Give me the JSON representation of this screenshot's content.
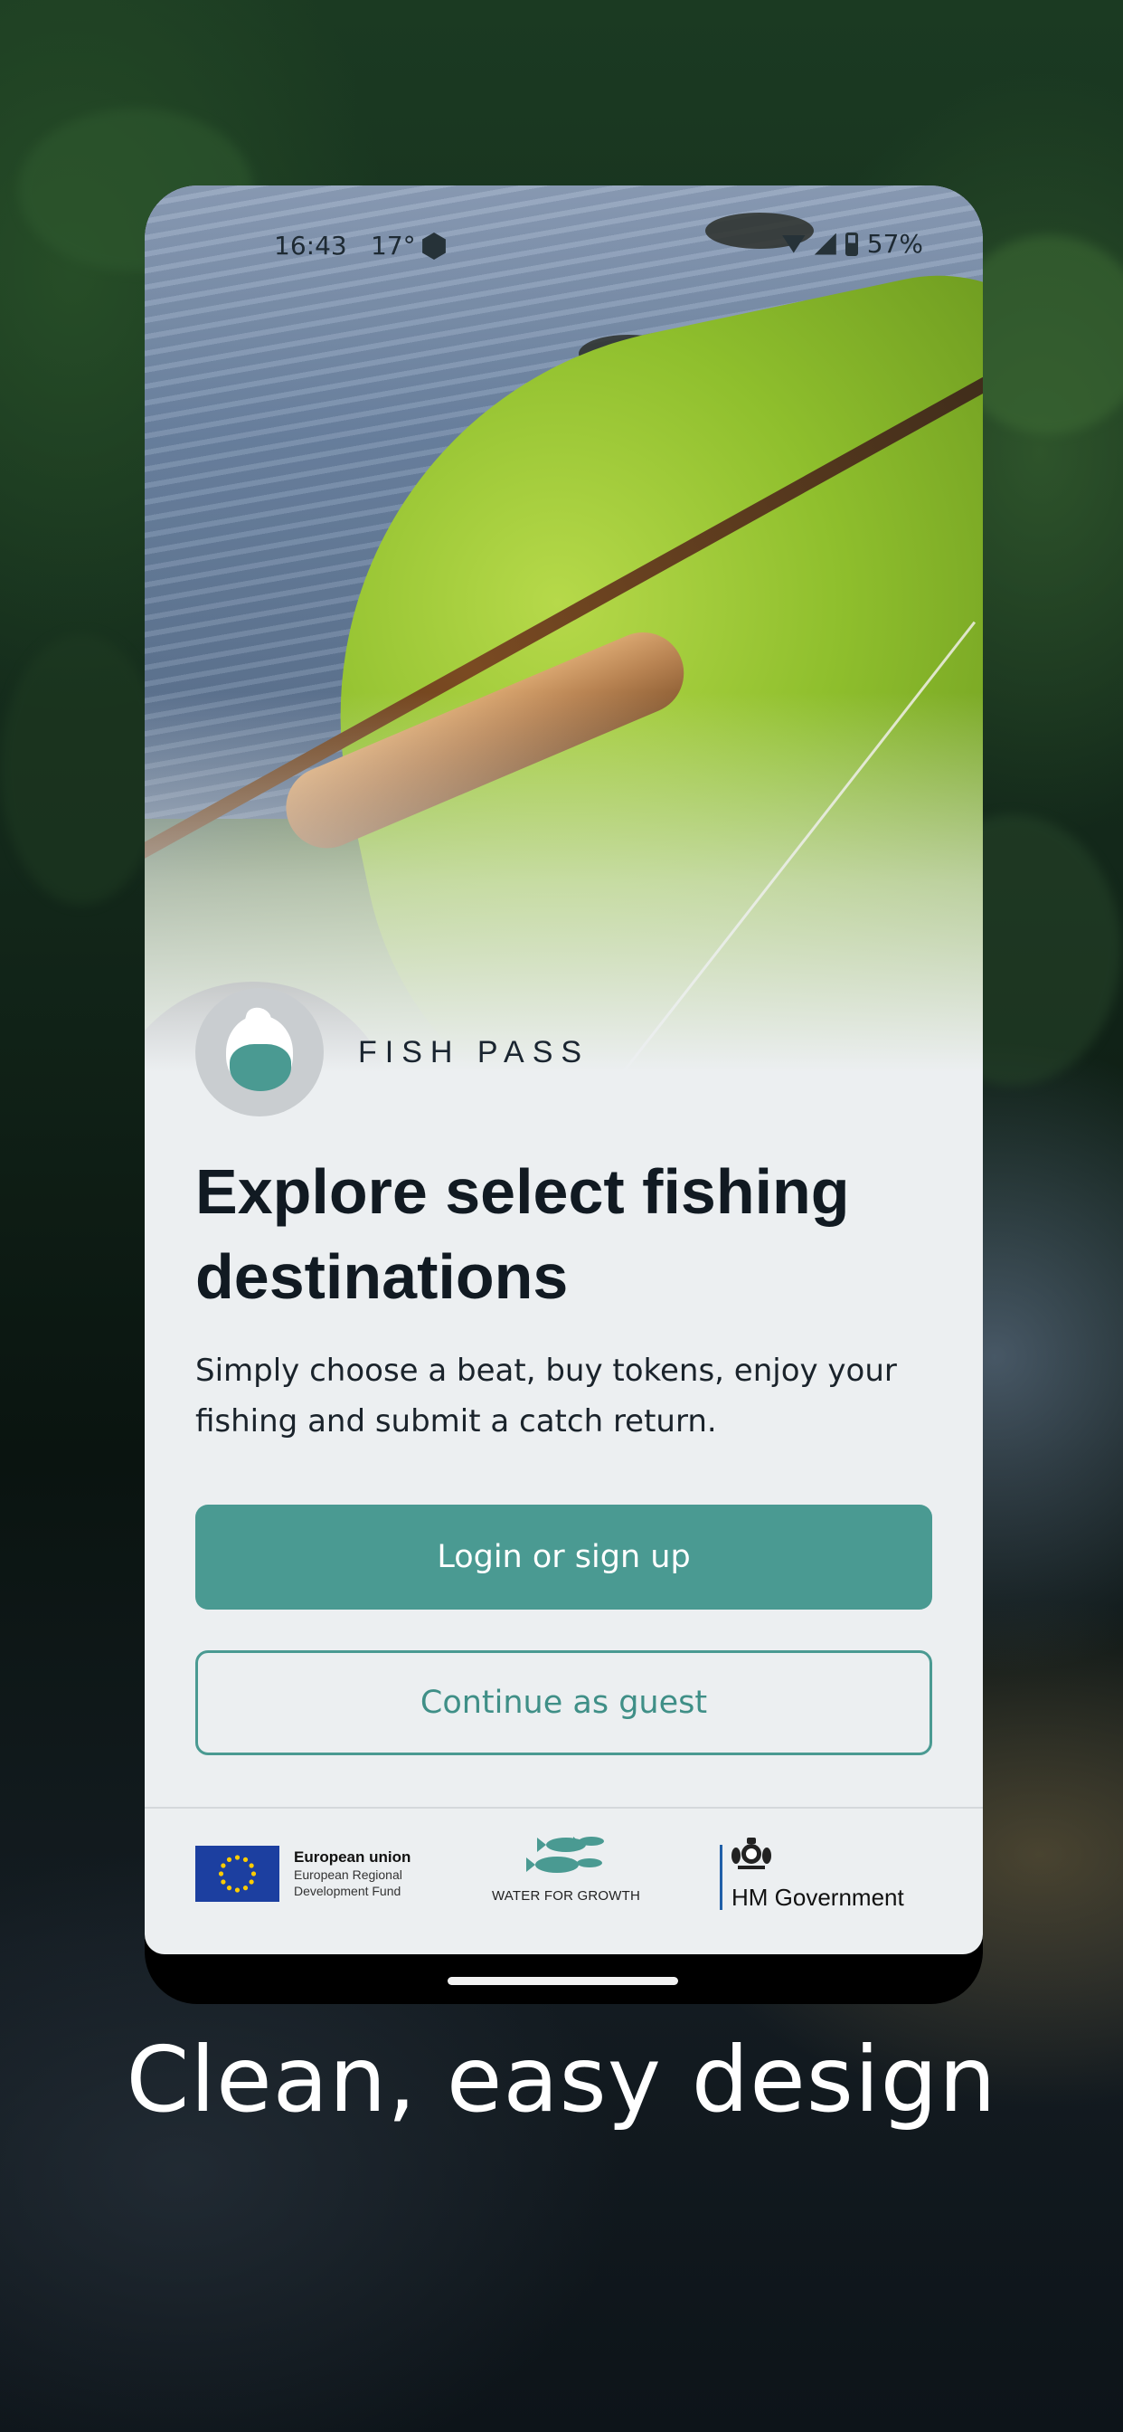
{
  "status_bar": {
    "time": "16:43",
    "temperature": "17°",
    "battery": "57%",
    "icons": [
      "weather-icon",
      "wifi-icon",
      "signal-icon",
      "battery-icon"
    ]
  },
  "brand": {
    "name": "FISH PASS",
    "logo_icon": "fish-logo-icon"
  },
  "headline": "Explore select fishing destinations",
  "subtitle": "Simply choose a beat, buy tokens, enjoy your fishing and submit a catch return.",
  "buttons": {
    "primary": "Login or sign up",
    "secondary": "Continue as guest"
  },
  "funders": {
    "eu_title": "European union",
    "eu_sub_1": "European Regional",
    "eu_sub_2": "Development Fund",
    "wfg": "WATER FOR GROWTH",
    "hmg": "HM Government"
  },
  "caption": "Clean, easy design",
  "colors": {
    "accent": "#4a9a92",
    "screen_bg": "#eceff1",
    "eu_blue": "#1c3fa0",
    "eu_star": "#ffcc00"
  }
}
